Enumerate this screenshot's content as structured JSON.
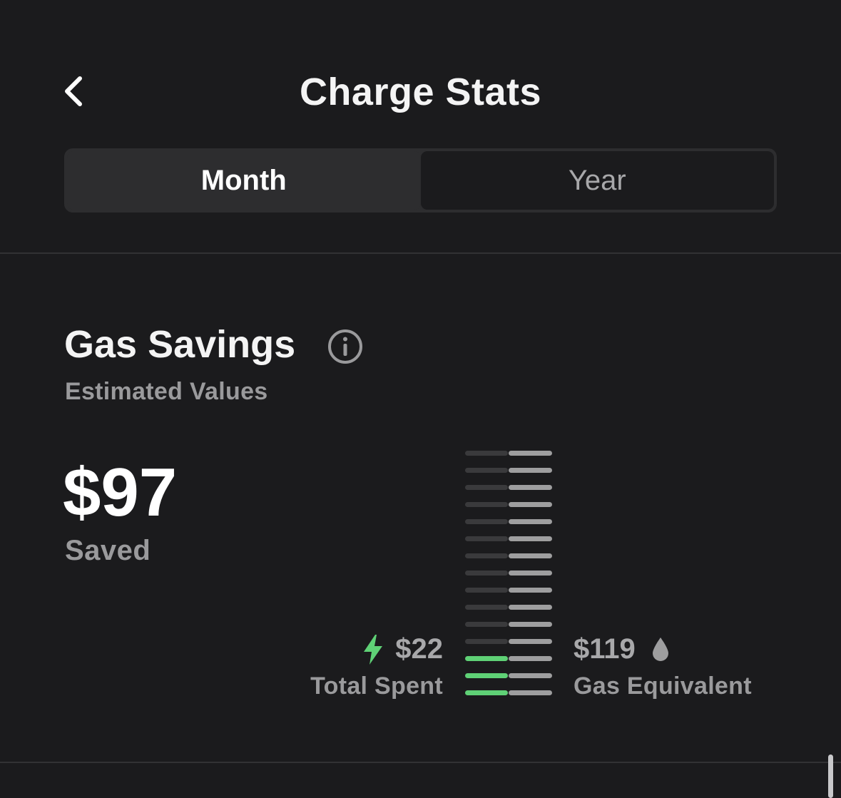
{
  "header": {
    "title": "Charge Stats"
  },
  "tabs": [
    {
      "label": "Month",
      "active": true
    },
    {
      "label": "Year",
      "active": false
    }
  ],
  "gas_savings": {
    "title": "Gas Savings",
    "subtitle": "Estimated Values",
    "saved_amount": "$97",
    "saved_label": "Saved",
    "total_spent": {
      "value": "$22",
      "label": "Total Spent",
      "icon": "lightning-bolt-icon"
    },
    "gas_equivalent": {
      "value": "$119",
      "label": "Gas Equivalent",
      "icon": "fuel-drop-icon"
    },
    "meter": {
      "segments": 15,
      "spent_filled_segments": 3
    }
  },
  "colors": {
    "background": "#1b1b1d",
    "accent_green": "#5fd176",
    "bar_gray": "#9e9e9f",
    "bar_dim": "#3a3a3c"
  }
}
